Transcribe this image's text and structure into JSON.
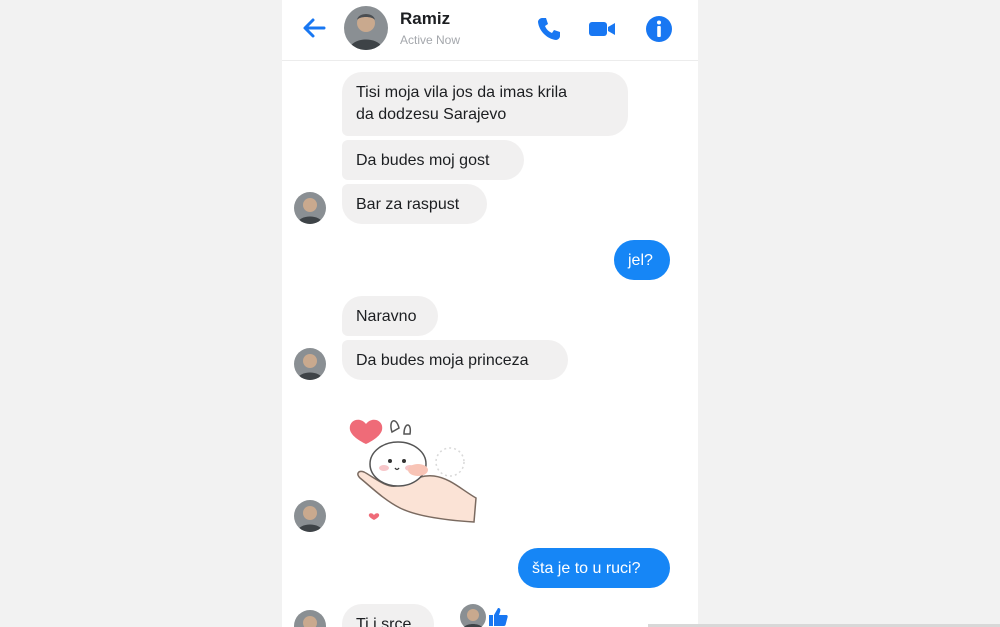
{
  "header": {
    "contact_name": "Ramiz",
    "status": "Active Now",
    "accent_color": "#1877f2"
  },
  "messages": [
    {
      "side": "in",
      "text_line1": "Tisi moja vila jos da imas krila",
      "text_line2": "da dodzesu Sarajevo"
    },
    {
      "side": "in",
      "text": "Da budes moj gost"
    },
    {
      "side": "in",
      "text": "Bar za raspust"
    },
    {
      "side": "out",
      "text": "jel?"
    },
    {
      "side": "in",
      "text": "Naravno"
    },
    {
      "side": "in",
      "text": "Da budes moja princeza"
    },
    {
      "side": "in",
      "type": "sticker",
      "sticker": "heart-bunny-hand-sticker"
    },
    {
      "side": "out",
      "text": "šta je to u ruci?"
    },
    {
      "side": "in",
      "text": "Ti i srce"
    }
  ],
  "icons": {
    "back": "back-arrow-icon",
    "call": "phone-icon",
    "video": "video-camera-icon",
    "info": "info-icon",
    "like": "thumbs-up-icon"
  },
  "colors": {
    "incoming_bubble": "#f1f0f0",
    "outgoing_bubble": "#1686f6"
  }
}
